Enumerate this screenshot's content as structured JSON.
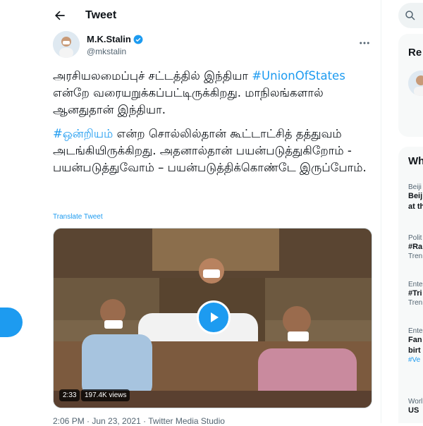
{
  "header": {
    "title": "Tweet"
  },
  "author": {
    "name": "M.K.Stalin",
    "handle": "@mkstalin"
  },
  "tweet": {
    "para1_a": "அரசியலமைப்புச் சட்டத்தில் இந்தியா ",
    "para1_tag": "#UnionOfStates",
    "para1_b": " என்றே வரையறுக்கப்பட்டிருக்கிறது. மாநிலங்களால் ஆனதுதான் இந்தியா.",
    "para2_tag": "#ஒன்றியம்",
    "para2_b": " என்ற சொல்லில்தான் கூட்டாட்சித் தத்துவம் அடங்கியிருக்கிறது. அதனால்தான் பயன்படுத்துகிறோம் - பயன்படுத்துவோம் – பயன்படுத்திக்கொண்டே இருப்போம்.",
    "translate": "Translate Tweet"
  },
  "media": {
    "duration": "2:33",
    "views": "197.4K views"
  },
  "meta": {
    "line": "2:06 PM · Jun 23, 2021 · Twitter Media Studio"
  },
  "sidebar": {
    "relevant_title": "Re",
    "trends_title": "Wh",
    "trends": [
      {
        "cat": "Beiji",
        "name1": "Beij",
        "name2": "at th"
      },
      {
        "cat": "Polit",
        "name1": "#Ra",
        "count": "Tren"
      },
      {
        "cat": "Ente",
        "name1": "#Tri",
        "count": "Tren"
      },
      {
        "cat": "Ente",
        "name1": "Fan",
        "name2": "birt",
        "blue": "#Ve"
      },
      {
        "cat": "Worl",
        "name1": "US"
      }
    ]
  },
  "colors": {
    "accent": "#1d9bf0",
    "text": "#0f1419",
    "muted": "#536471"
  }
}
